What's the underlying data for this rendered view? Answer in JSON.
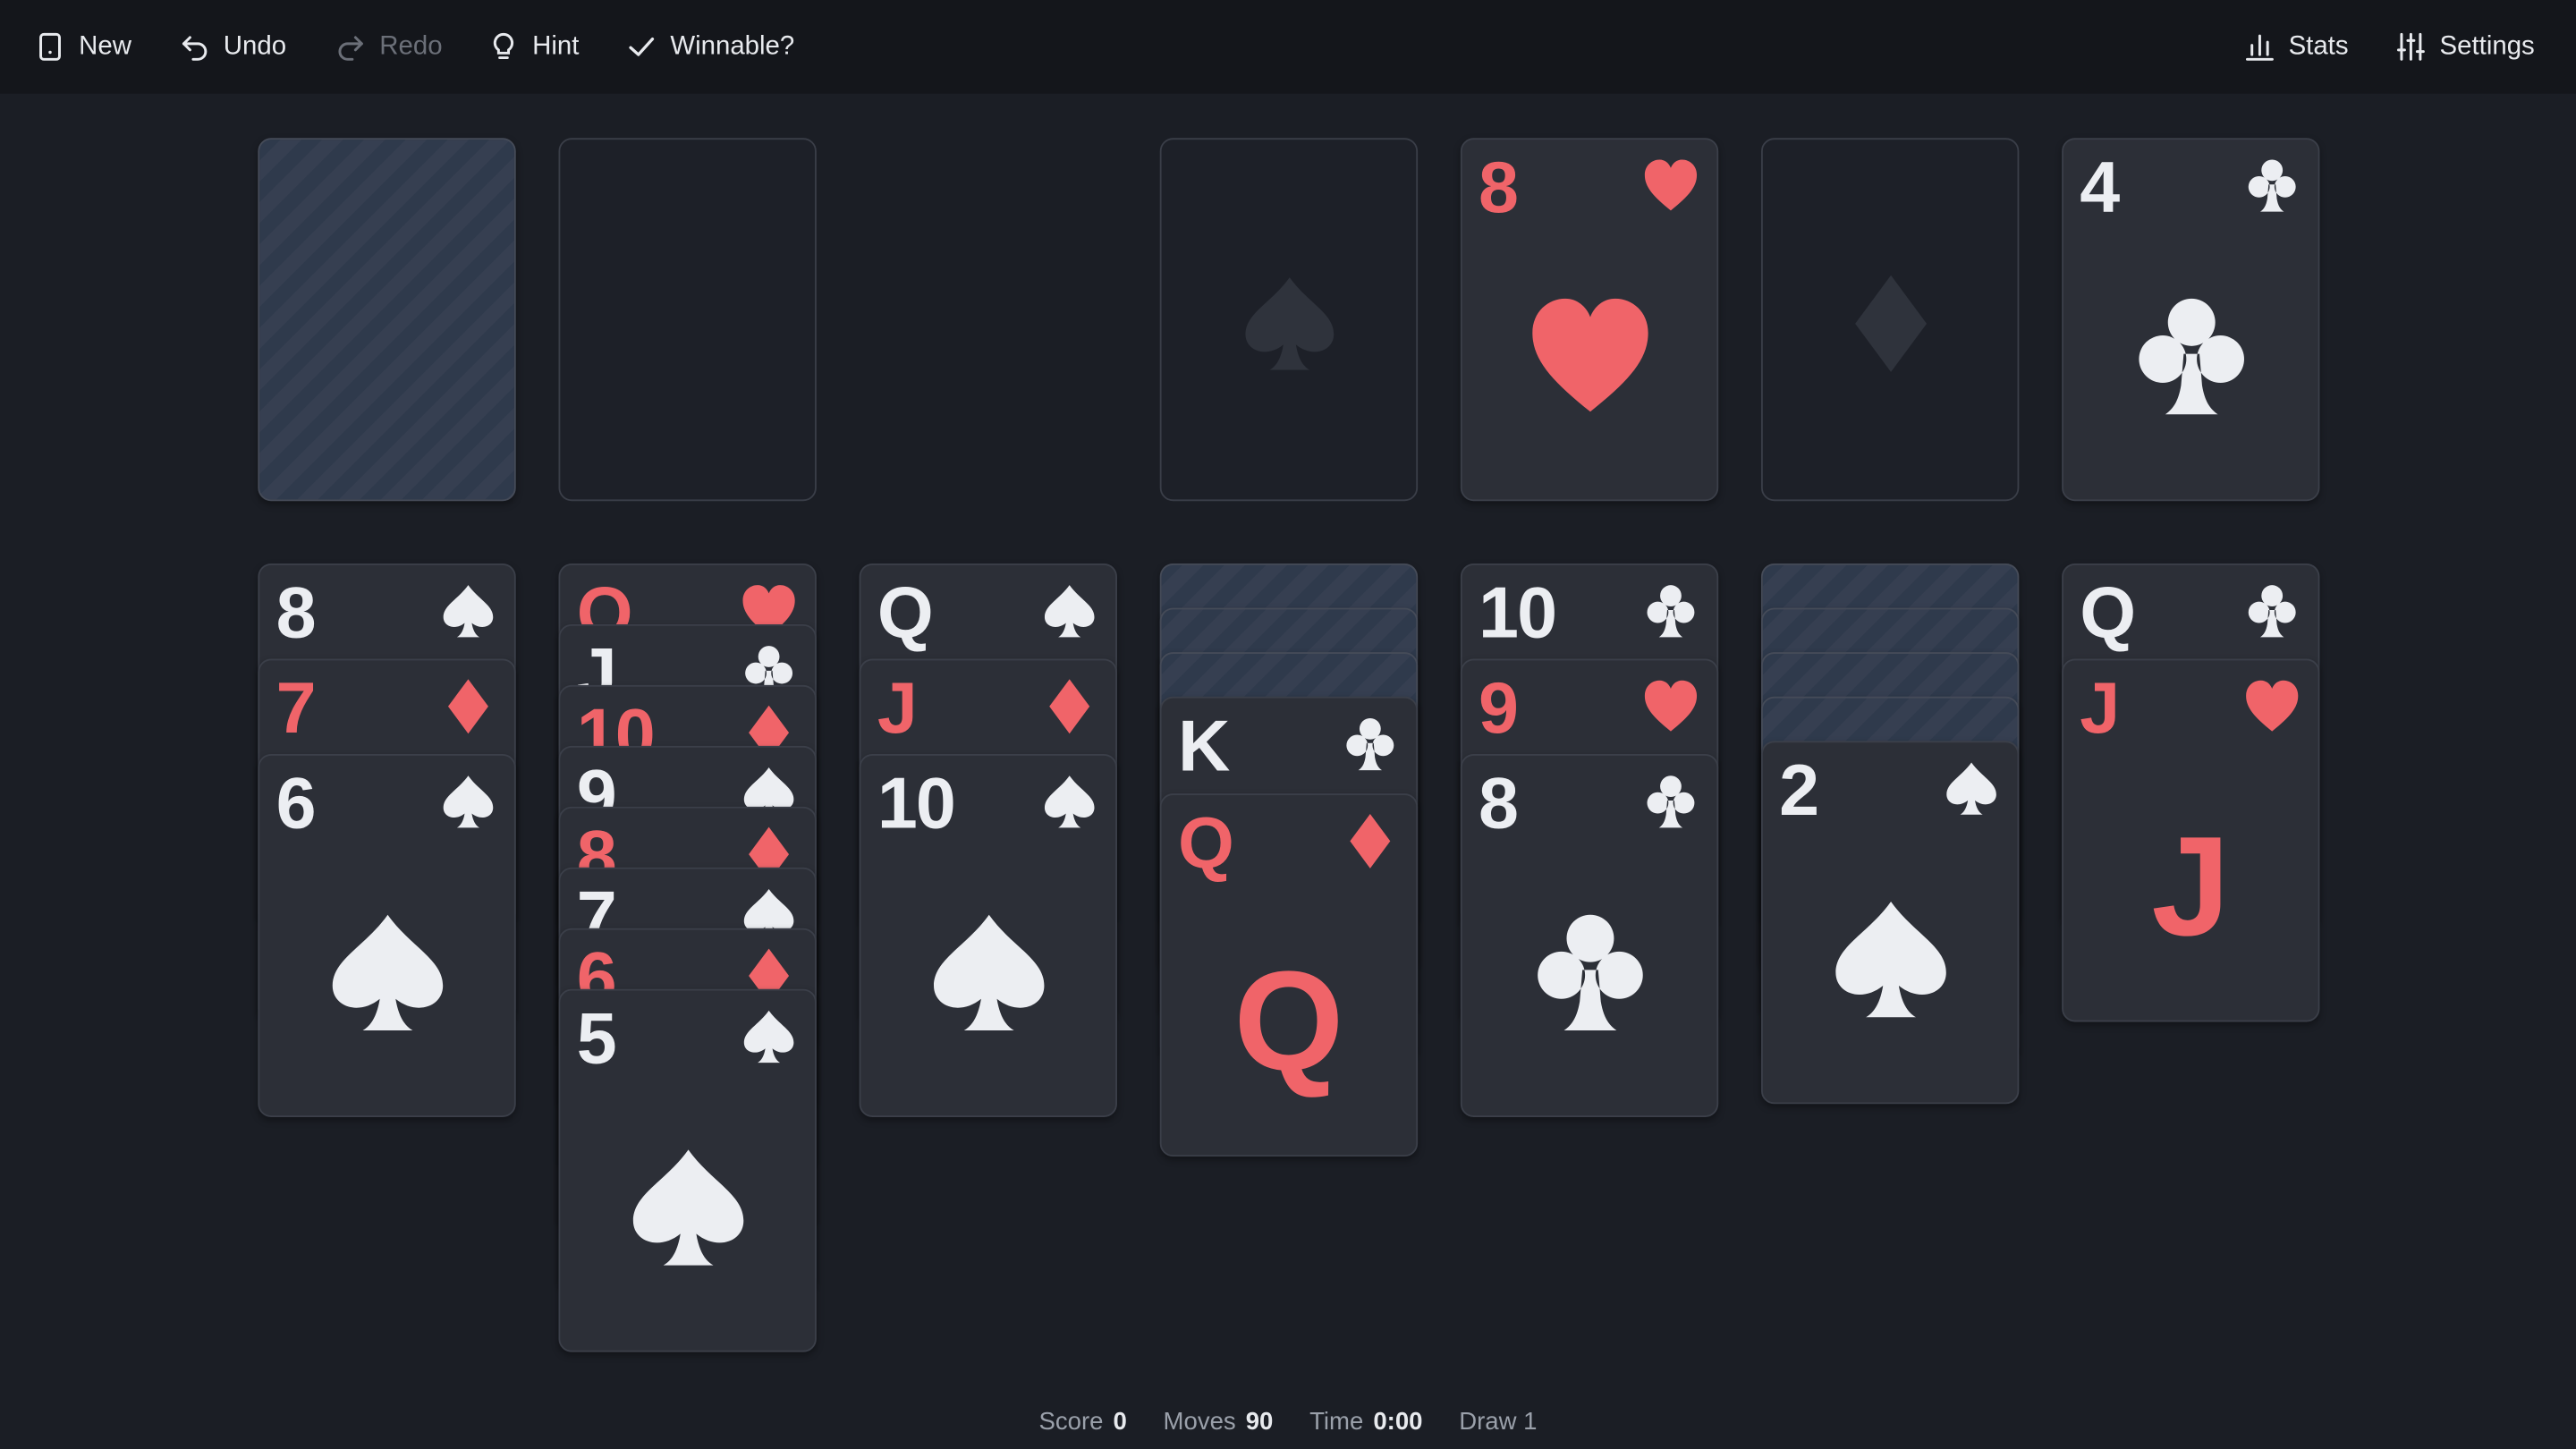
{
  "toolbar": {
    "new_label": "New",
    "undo_label": "Undo",
    "redo_label": "Redo",
    "hint_label": "Hint",
    "winnable_label": "Winnable?",
    "stats_label": "Stats",
    "settings_label": "Settings"
  },
  "colors": {
    "red": "#f06469",
    "black_suit": "#eceef2",
    "card_bg": "#2c2f37",
    "table_bg": "#1b1e25"
  },
  "stock": {
    "face_down": true
  },
  "waste": {
    "empty": true
  },
  "foundations": [
    {
      "empty": true,
      "placeholder_suit": "spades"
    },
    {
      "rank": "8",
      "suit": "hearts"
    },
    {
      "empty": true,
      "placeholder_suit": "diamonds"
    },
    {
      "rank": "4",
      "suit": "clubs"
    }
  ],
  "tableau": [
    {
      "face_down": 0,
      "cards": [
        {
          "rank": "8",
          "suit": "spades"
        },
        {
          "rank": "7",
          "suit": "diamonds"
        },
        {
          "rank": "6",
          "suit": "spades"
        }
      ]
    },
    {
      "face_down": 0,
      "cards": [
        {
          "rank": "Q",
          "suit": "hearts"
        },
        {
          "rank": "J",
          "suit": "clubs"
        },
        {
          "rank": "10",
          "suit": "diamonds"
        },
        {
          "rank": "9",
          "suit": "spades"
        },
        {
          "rank": "8",
          "suit": "diamonds"
        },
        {
          "rank": "7",
          "suit": "spades"
        },
        {
          "rank": "6",
          "suit": "diamonds"
        },
        {
          "rank": "5",
          "suit": "spades"
        }
      ]
    },
    {
      "face_down": 0,
      "cards": [
        {
          "rank": "Q",
          "suit": "spades"
        },
        {
          "rank": "J",
          "suit": "diamonds"
        },
        {
          "rank": "10",
          "suit": "spades"
        }
      ]
    },
    {
      "face_down": 3,
      "cards": [
        {
          "rank": "K",
          "suit": "clubs"
        },
        {
          "rank": "Q",
          "suit": "diamonds"
        }
      ]
    },
    {
      "face_down": 0,
      "cards": [
        {
          "rank": "10",
          "suit": "clubs"
        },
        {
          "rank": "9",
          "suit": "hearts"
        },
        {
          "rank": "8",
          "suit": "clubs"
        }
      ]
    },
    {
      "face_down": 4,
      "cards": [
        {
          "rank": "2",
          "suit": "spades"
        }
      ]
    },
    {
      "face_down": 0,
      "cards": [
        {
          "rank": "Q",
          "suit": "clubs"
        },
        {
          "rank": "J",
          "suit": "hearts"
        }
      ]
    }
  ],
  "status": {
    "score_label": "Score",
    "score": "0",
    "moves_label": "Moves",
    "moves": "90",
    "time_label": "Time",
    "time": "0:00",
    "draw_label": "Draw 1"
  }
}
